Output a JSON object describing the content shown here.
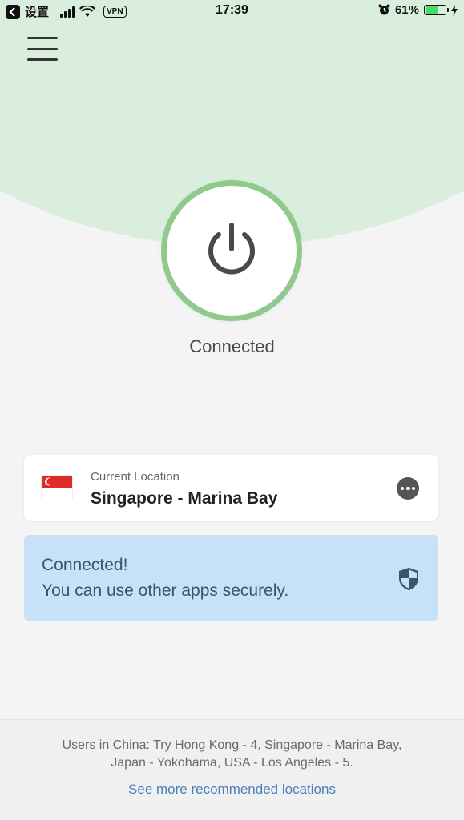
{
  "status_bar": {
    "back_app": "设置",
    "vpn_badge": "VPN",
    "time": "17:39",
    "battery_percent": "61%",
    "battery_level": 0.61,
    "icons": [
      "back-icon",
      "signal-icon",
      "wifi-icon",
      "alarm-icon",
      "battery-icon",
      "charging-icon"
    ]
  },
  "header": {
    "menu_icon": "hamburger-menu-icon"
  },
  "connection": {
    "power_icon": "power-icon",
    "status": "Connected",
    "ring_color": "#8fca8c",
    "background_color": "#d9eedc"
  },
  "location_card": {
    "label": "Current Location",
    "name": "Singapore - Marina Bay",
    "flag_icon": "singapore-flag-icon",
    "more_icon": "more-options-icon"
  },
  "banner": {
    "title": "Connected!",
    "subtitle": "You can use other apps securely.",
    "icon": "shield-icon",
    "color": "#c7e1f8"
  },
  "footer": {
    "note_line1": "Users in China: Try Hong Kong - 4, Singapore - Marina Bay,",
    "note_line2": "Japan - Yokohama, USA - Los Angeles - 5.",
    "link": "See more recommended locations",
    "link_color": "#4a7fc1"
  }
}
